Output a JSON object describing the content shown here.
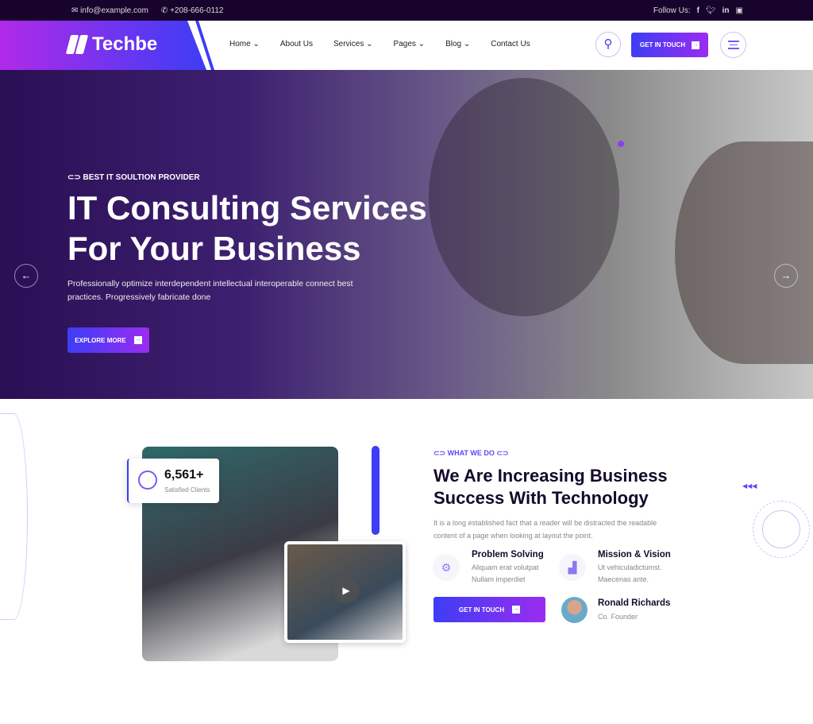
{
  "topbar": {
    "email": "info@example.com",
    "phone": "+208-666-0112",
    "follow_label": "Follow Us:",
    "socials": [
      "facebook-icon",
      "twitter-icon",
      "linkedin-icon",
      "youtube-icon"
    ]
  },
  "header": {
    "logo": "Techbe",
    "nav": [
      {
        "label": "Home",
        "dropdown": true
      },
      {
        "label": "About Us",
        "dropdown": false
      },
      {
        "label": "Services",
        "dropdown": true
      },
      {
        "label": "Pages",
        "dropdown": true
      },
      {
        "label": "Blog",
        "dropdown": true
      },
      {
        "label": "Contact Us",
        "dropdown": false
      }
    ],
    "cta": "GET IN TOUCH"
  },
  "hero": {
    "tag": "BEST IT SOULTION PROVIDER",
    "title_line1": "IT Consulting Services",
    "title_line2": "For Your Business",
    "desc": "Professionally optimize interdependent intellectual interoperable connect best practices. Progressively fabricate done",
    "button": "EXPLORE MORE"
  },
  "about": {
    "stat_value": "6,561+",
    "stat_label": "Satisfied Clients",
    "tag": "WHAT WE DO",
    "title": "We Are Increasing Business Success With Technology",
    "desc": "It is a long established fact that a reader will be distracted the readable content of a page when looking at layout the point.",
    "features": [
      {
        "title": "Problem Solving",
        "desc": "Aliquam erat volutpat Nullam imperdiet"
      },
      {
        "title": "Mission & Vision",
        "desc": "Ut vehiculadictumst. Maecenas ante."
      }
    ],
    "button": "GET IN TOUCH",
    "person_name": "Ronald Richards",
    "person_role": "Co. Founder"
  },
  "colors": {
    "primary": "#3d3df5",
    "accent": "#9b2cf0",
    "topbar": "#17032b"
  }
}
